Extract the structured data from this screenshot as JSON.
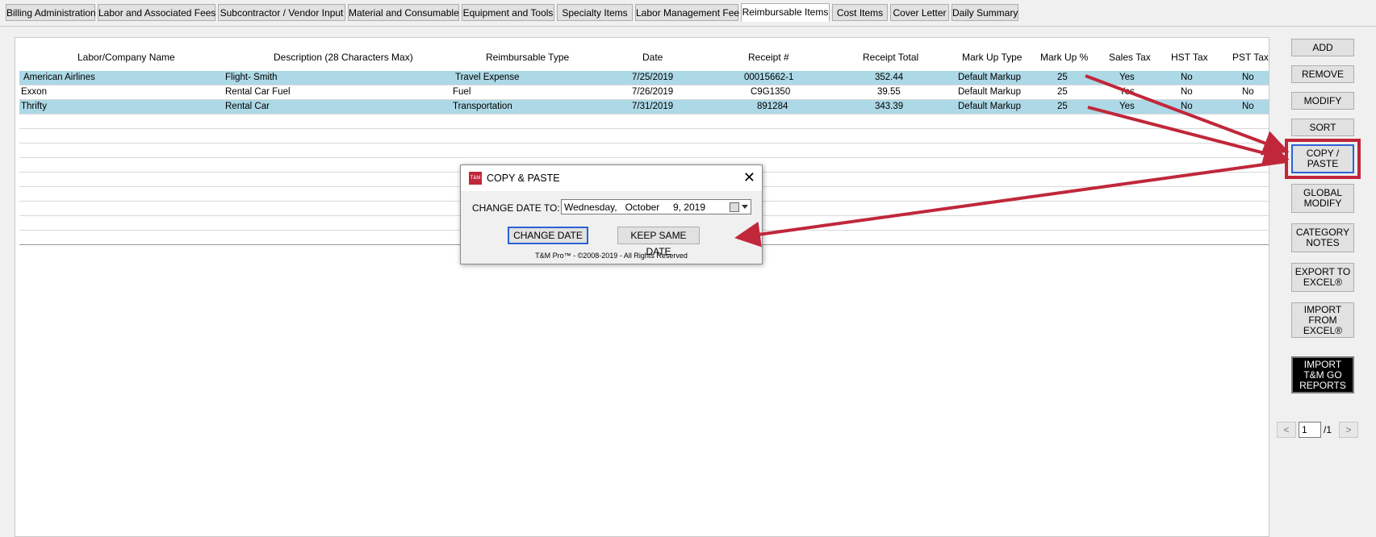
{
  "tabs": [
    {
      "label": "Billing Administration",
      "active": false
    },
    {
      "label": "Labor and Associated Fees",
      "active": false
    },
    {
      "label": "Subcontractor / Vendor Input",
      "active": false
    },
    {
      "label": "Material and Consumable",
      "active": false
    },
    {
      "label": "Equipment and Tools",
      "active": false
    },
    {
      "label": "Specialty Items",
      "active": false
    },
    {
      "label": "Labor Management Fee",
      "active": false
    },
    {
      "label": "Reimbursable Items",
      "active": true
    },
    {
      "label": "Cost Items",
      "active": false
    },
    {
      "label": "Cover Letter",
      "active": false
    },
    {
      "label": "Daily Summary",
      "active": false
    }
  ],
  "table": {
    "columns": [
      "Labor/Company Name",
      "Description (28 Characters Max)",
      "Reimbursable Type",
      "Date",
      "Receipt #",
      "Receipt Total",
      "Mark Up Type",
      "Mark Up %",
      "Sales Tax",
      "HST Tax",
      "PST Tax"
    ],
    "rows": [
      {
        "selected": true,
        "cells": [
          "American Airlines",
          "Flight- Smith",
          "Travel Expense",
          "7/25/2019",
          "00015662-1",
          "352.44",
          "Default Markup",
          "25",
          "Yes",
          "No",
          "No"
        ]
      },
      {
        "selected": false,
        "cells": [
          "Exxon",
          "Rental Car Fuel",
          "Fuel",
          "7/26/2019",
          "C9G1350",
          "39.55",
          "Default Markup",
          "25",
          "Yes",
          "No",
          "No"
        ]
      },
      {
        "selected": true,
        "cells": [
          "Thrifty",
          "Rental Car",
          "Transportation",
          "7/31/2019",
          "891284",
          "343.39",
          "Default Markup",
          "25",
          "Yes",
          "No",
          "No"
        ]
      }
    ]
  },
  "sidebar": {
    "buttons": [
      {
        "label": "ADD"
      },
      {
        "label": "REMOVE"
      },
      {
        "label": "MODIFY"
      },
      {
        "label": "SORT"
      },
      {
        "label": "COPY / PASTE"
      },
      {
        "label": "GLOBAL MODIFY"
      },
      {
        "label": "CATEGORY NOTES"
      },
      {
        "label": "EXPORT TO EXCEL®"
      },
      {
        "label": "IMPORT FROM EXCEL®"
      },
      {
        "label": "IMPORT T&M GO REPORTS"
      }
    ]
  },
  "pager": {
    "prev": "<",
    "page": "1",
    "total": "/1",
    "next": ">"
  },
  "dialog": {
    "logo": "T&M",
    "title": "COPY & PASTE",
    "change_date_label": "CHANGE DATE TO:",
    "date_value": "Wednesday,   October     9, 2019",
    "change_date_button": "CHANGE DATE",
    "keep_same_date_button": "KEEP SAME DATE",
    "copyright": "T&M Pro™ - ©2008-2019 - All Rights Reserved",
    "close": "✕"
  },
  "colors": {
    "selected_row": "#add8e6",
    "annotation_red": "#c0273a",
    "focus_blue": "#2a63d4"
  }
}
